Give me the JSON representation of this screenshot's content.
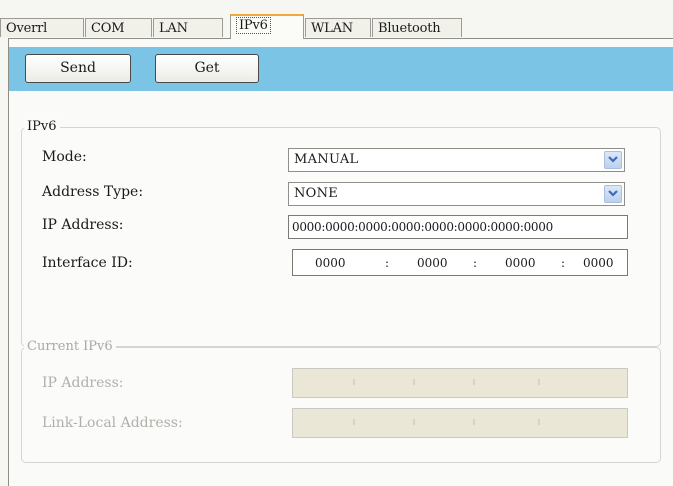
{
  "tabs": [
    {
      "label": "Overrl",
      "active": false
    },
    {
      "label": "COM",
      "active": false
    },
    {
      "label": "LAN",
      "active": false
    },
    {
      "label": "IPv6",
      "active": true
    },
    {
      "label": "WLAN",
      "active": false
    },
    {
      "label": "Bluetooth",
      "active": false
    }
  ],
  "toolbar": {
    "send_label": "Send",
    "get_label": "Get"
  },
  "ipv6": {
    "legend": "IPv6",
    "mode_label": "Mode:",
    "mode_value": "MANUAL",
    "address_type_label": "Address Type:",
    "address_type_value": "NONE",
    "ip_address_label": "IP Address:",
    "ip_address_value": "0000:0000:0000:0000:0000:0000:0000:0000",
    "interface_id_label": "Interface ID:",
    "interface_id_parts": [
      "0000",
      "0000",
      "0000",
      "0000"
    ],
    "interface_id_sep": ":"
  },
  "current_ipv6": {
    "legend": "Current IPv6",
    "ip_address_label": "IP Address:",
    "link_local_label": "Link-Local Address:"
  },
  "colors": {
    "toolbar": "#7cc4e6",
    "active_tab_accent": "#f0a83a",
    "select_arrow": "#3b6cc0"
  }
}
